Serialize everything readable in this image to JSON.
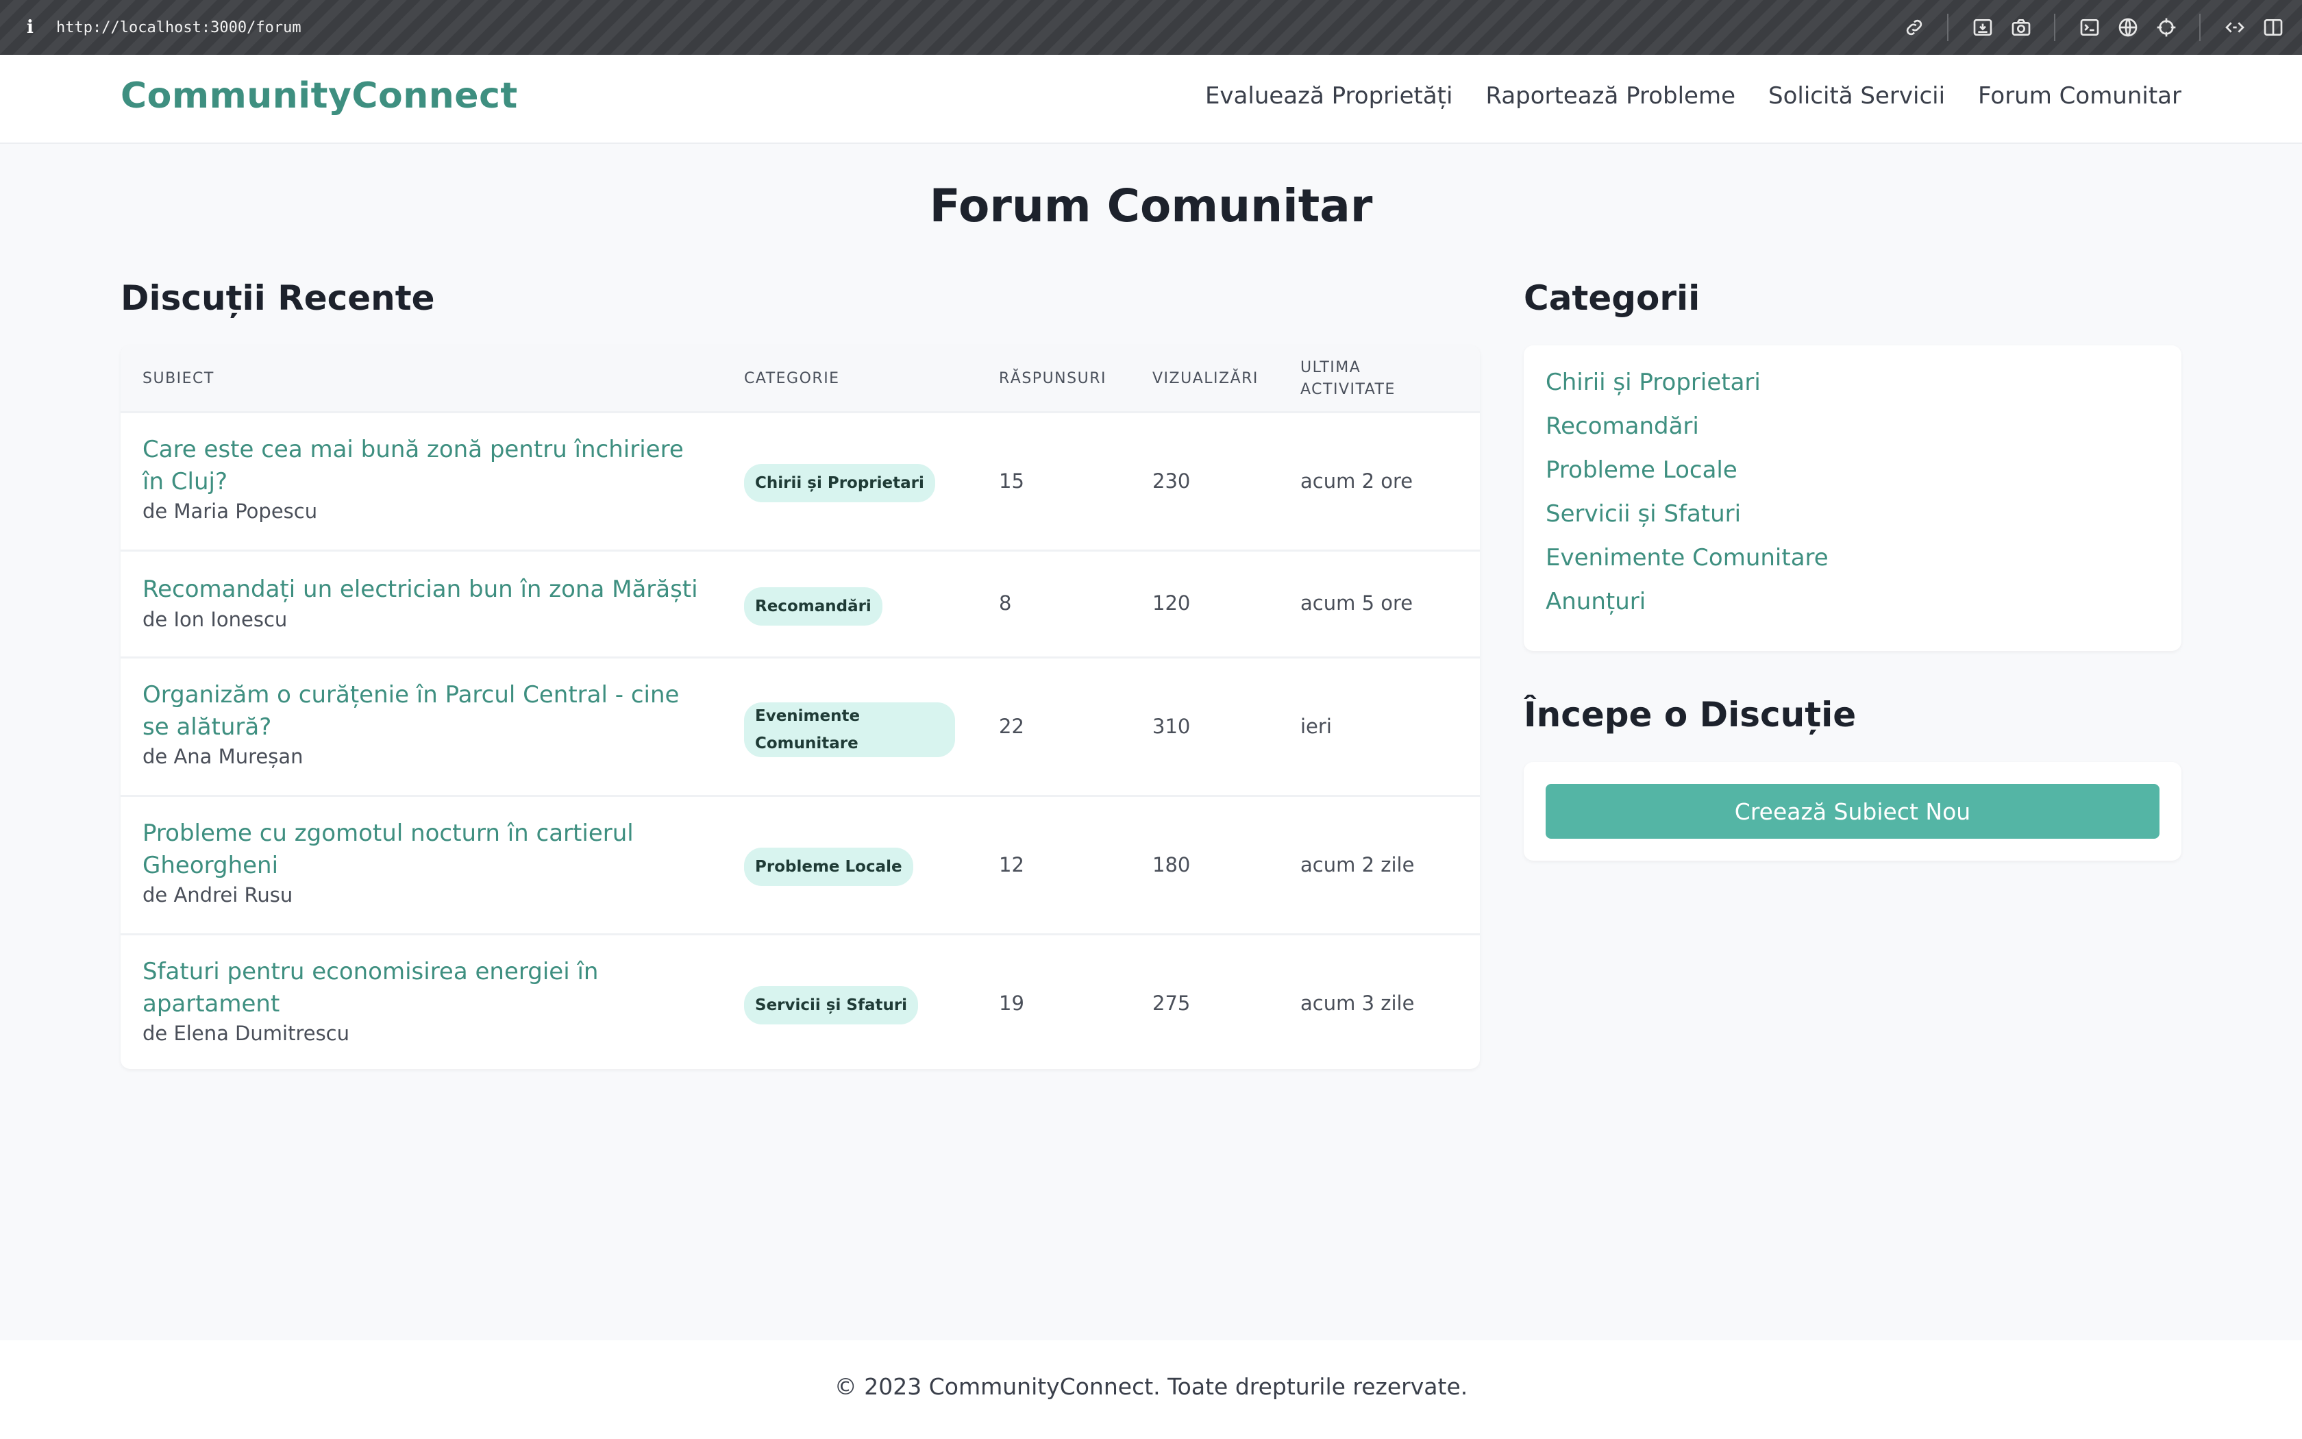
{
  "browser": {
    "info_glyph": "i",
    "url": "http://localhost:3000/forum"
  },
  "header": {
    "logo": "CommunityConnect",
    "nav": [
      {
        "label": "Evaluează Proprietăți"
      },
      {
        "label": "Raportează Probleme"
      },
      {
        "label": "Solicită Servicii"
      },
      {
        "label": "Forum Comunitar"
      }
    ]
  },
  "page": {
    "title": "Forum Comunitar"
  },
  "discussions": {
    "title": "Discuții Recente",
    "columns": {
      "subject": "SUBIECT",
      "category": "CATEGORIE",
      "replies": "RĂSPUNSURI",
      "views": "VIZUALIZĂRI",
      "last_activity_1": "ULTIMA",
      "last_activity_2": "ACTIVITATE"
    },
    "rows": [
      {
        "topic": "Care este cea mai bună zonă pentru închiriere în Cluj?",
        "author": "de Maria Popescu",
        "category": "Chirii și Proprietari",
        "replies": "15",
        "views": "230",
        "last": "acum 2 ore"
      },
      {
        "topic": "Recomandați un electrician bun în zona Mărăști",
        "author": "de Ion Ionescu",
        "category": "Recomandări",
        "replies": "8",
        "views": "120",
        "last": "acum 5 ore"
      },
      {
        "topic": "Organizăm o curățenie în Parcul Central - cine se alătură?",
        "author": "de Ana Mureșan",
        "category": "Evenimente Comunitare",
        "replies": "22",
        "views": "310",
        "last": "ieri"
      },
      {
        "topic": "Probleme cu zgomotul nocturn în cartierul Gheorgheni",
        "author": "de Andrei Rusu",
        "category": "Probleme Locale",
        "replies": "12",
        "views": "180",
        "last": "acum 2 zile"
      },
      {
        "topic": "Sfaturi pentru economisirea energiei în apartament",
        "author": "de Elena Dumitrescu",
        "category": "Servicii și Sfaturi",
        "replies": "19",
        "views": "275",
        "last": "acum 3 zile"
      }
    ]
  },
  "categories": {
    "title": "Categorii",
    "items": [
      "Chirii și Proprietari",
      "Recomandări",
      "Probleme Locale",
      "Servicii și Sfaturi",
      "Evenimente Comunitare",
      "Anunțuri"
    ]
  },
  "start": {
    "title": "Începe o Discuție",
    "button": "Creează Subiect Nou"
  },
  "footer": {
    "text": "© 2023 CommunityConnect. Toate drepturile rezervate."
  },
  "colors": {
    "brand": "#3e8f80",
    "button": "#54b5a5",
    "badge_bg": "#d8f4ef"
  }
}
